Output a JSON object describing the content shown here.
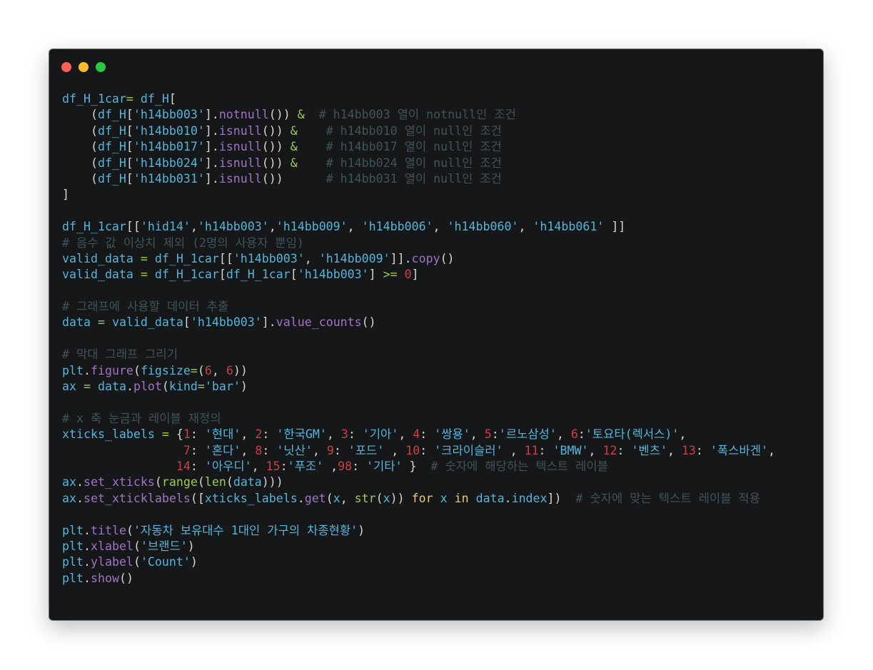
{
  "window": {
    "controls": [
      {
        "name": "close",
        "color": "#ff5f57"
      },
      {
        "name": "minimize",
        "color": "#febc2e"
      },
      {
        "name": "maximize",
        "color": "#28c840"
      }
    ]
  },
  "code_lines": [
    [
      [
        "v",
        "df_H_1car"
      ],
      [
        "o",
        "="
      ],
      [
        "p",
        " "
      ],
      [
        "v",
        "df_H"
      ],
      [
        "p",
        "["
      ]
    ],
    [
      [
        "p",
        "    ("
      ],
      [
        "v",
        "df_H"
      ],
      [
        "p",
        "["
      ],
      [
        "s",
        "'h14bb003'"
      ],
      [
        "p",
        "]."
      ],
      [
        "f",
        "notnull"
      ],
      [
        "p",
        "()) "
      ],
      [
        "o",
        "&"
      ],
      [
        "p",
        "  "
      ],
      [
        "c",
        "# h14bb003 열이 notnull인 조건"
      ]
    ],
    [
      [
        "p",
        "    ("
      ],
      [
        "v",
        "df_H"
      ],
      [
        "p",
        "["
      ],
      [
        "s",
        "'h14bb010'"
      ],
      [
        "p",
        "]."
      ],
      [
        "f",
        "isnull"
      ],
      [
        "p",
        "()) "
      ],
      [
        "o",
        "&"
      ],
      [
        "p",
        "    "
      ],
      [
        "c",
        "# h14bb010 열이 null인 조건"
      ]
    ],
    [
      [
        "p",
        "    ("
      ],
      [
        "v",
        "df_H"
      ],
      [
        "p",
        "["
      ],
      [
        "s",
        "'h14bb017'"
      ],
      [
        "p",
        "]."
      ],
      [
        "f",
        "isnull"
      ],
      [
        "p",
        "()) "
      ],
      [
        "o",
        "&"
      ],
      [
        "p",
        "    "
      ],
      [
        "c",
        "# h14bb017 열이 null인 조건"
      ]
    ],
    [
      [
        "p",
        "    ("
      ],
      [
        "v",
        "df_H"
      ],
      [
        "p",
        "["
      ],
      [
        "s",
        "'h14bb024'"
      ],
      [
        "p",
        "]."
      ],
      [
        "f",
        "isnull"
      ],
      [
        "p",
        "()) "
      ],
      [
        "o",
        "&"
      ],
      [
        "p",
        "    "
      ],
      [
        "c",
        "# h14bb024 열이 null인 조건"
      ]
    ],
    [
      [
        "p",
        "    ("
      ],
      [
        "v",
        "df_H"
      ],
      [
        "p",
        "["
      ],
      [
        "s",
        "'h14bb031'"
      ],
      [
        "p",
        "]."
      ],
      [
        "f",
        "isnull"
      ],
      [
        "p",
        "())      "
      ],
      [
        "c",
        "# h14bb031 열이 null인 조건"
      ]
    ],
    [
      [
        "p",
        "]"
      ]
    ],
    [],
    [
      [
        "v",
        "df_H_1car"
      ],
      [
        "p",
        "[["
      ],
      [
        "s",
        "'hid14'"
      ],
      [
        "p",
        ","
      ],
      [
        "s",
        "'h14bb003'"
      ],
      [
        "p",
        ","
      ],
      [
        "s",
        "'h14bb009'"
      ],
      [
        "p",
        ", "
      ],
      [
        "s",
        "'h14bb006'"
      ],
      [
        "p",
        ", "
      ],
      [
        "s",
        "'h14bb060'"
      ],
      [
        "p",
        ", "
      ],
      [
        "s",
        "'h14bb061'"
      ],
      [
        "p",
        " ]]"
      ]
    ],
    [
      [
        "c",
        "# 음수 값 이상치 제외 (2명의 사용자 뿐임)"
      ]
    ],
    [
      [
        "v",
        "valid_data"
      ],
      [
        "p",
        " "
      ],
      [
        "o",
        "="
      ],
      [
        "p",
        " "
      ],
      [
        "v",
        "df_H_1car"
      ],
      [
        "p",
        "[["
      ],
      [
        "s",
        "'h14bb003'"
      ],
      [
        "p",
        ", "
      ],
      [
        "s",
        "'h14bb009'"
      ],
      [
        "p",
        "]]."
      ],
      [
        "f",
        "copy"
      ],
      [
        "p",
        "()"
      ]
    ],
    [
      [
        "v",
        "valid_data"
      ],
      [
        "p",
        " "
      ],
      [
        "o",
        "="
      ],
      [
        "p",
        " "
      ],
      [
        "v",
        "df_H_1car"
      ],
      [
        "p",
        "["
      ],
      [
        "v",
        "df_H_1car"
      ],
      [
        "p",
        "["
      ],
      [
        "s",
        "'h14bb003'"
      ],
      [
        "p",
        "] "
      ],
      [
        "o",
        ">="
      ],
      [
        "p",
        " "
      ],
      [
        "n",
        "0"
      ],
      [
        "p",
        "]"
      ]
    ],
    [],
    [
      [
        "c",
        "# 그래프에 사용할 데이터 추출"
      ]
    ],
    [
      [
        "v",
        "data"
      ],
      [
        "p",
        " "
      ],
      [
        "o",
        "="
      ],
      [
        "p",
        " "
      ],
      [
        "v",
        "valid_data"
      ],
      [
        "p",
        "["
      ],
      [
        "s",
        "'h14bb003'"
      ],
      [
        "p",
        "]."
      ],
      [
        "f",
        "value_counts"
      ],
      [
        "p",
        "()"
      ]
    ],
    [],
    [
      [
        "c",
        "# 막대 그래프 그리기"
      ]
    ],
    [
      [
        "v",
        "plt"
      ],
      [
        "p",
        "."
      ],
      [
        "f",
        "figure"
      ],
      [
        "p",
        "("
      ],
      [
        "v",
        "figsize"
      ],
      [
        "o",
        "="
      ],
      [
        "p",
        "("
      ],
      [
        "n",
        "6"
      ],
      [
        "p",
        ", "
      ],
      [
        "n",
        "6"
      ],
      [
        "p",
        "))"
      ]
    ],
    [
      [
        "v",
        "ax"
      ],
      [
        "p",
        " "
      ],
      [
        "o",
        "="
      ],
      [
        "p",
        " "
      ],
      [
        "v",
        "data"
      ],
      [
        "p",
        "."
      ],
      [
        "f",
        "plot"
      ],
      [
        "p",
        "("
      ],
      [
        "v",
        "kind"
      ],
      [
        "o",
        "="
      ],
      [
        "s",
        "'bar'"
      ],
      [
        "p",
        ")"
      ]
    ],
    [],
    [
      [
        "c",
        "# x 축 눈금과 레이블 재정의"
      ]
    ],
    [
      [
        "v",
        "xticks_labels"
      ],
      [
        "p",
        " "
      ],
      [
        "o",
        "="
      ],
      [
        "p",
        " {"
      ],
      [
        "n",
        "1"
      ],
      [
        "p",
        ": "
      ],
      [
        "s",
        "'현대'"
      ],
      [
        "p",
        ", "
      ],
      [
        "n",
        "2"
      ],
      [
        "p",
        ": "
      ],
      [
        "s",
        "'한국GM'"
      ],
      [
        "p",
        ", "
      ],
      [
        "n",
        "3"
      ],
      [
        "p",
        ": "
      ],
      [
        "s",
        "'기아'"
      ],
      [
        "p",
        ", "
      ],
      [
        "n",
        "4"
      ],
      [
        "p",
        ": "
      ],
      [
        "s",
        "'쌍용'"
      ],
      [
        "p",
        ", "
      ],
      [
        "n",
        "5"
      ],
      [
        "p",
        ":"
      ],
      [
        "s",
        "'르노삼성'"
      ],
      [
        "p",
        ", "
      ],
      [
        "n",
        "6"
      ],
      [
        "p",
        ":"
      ],
      [
        "s",
        "'토요타(렉서스)'"
      ],
      [
        "p",
        ","
      ]
    ],
    [
      [
        "p",
        "                 "
      ],
      [
        "n",
        "7"
      ],
      [
        "p",
        ": "
      ],
      [
        "s",
        "'혼다'"
      ],
      [
        "p",
        ", "
      ],
      [
        "n",
        "8"
      ],
      [
        "p",
        ": "
      ],
      [
        "s",
        "'닛산'"
      ],
      [
        "p",
        ", "
      ],
      [
        "n",
        "9"
      ],
      [
        "p",
        ": "
      ],
      [
        "s",
        "'포드'"
      ],
      [
        "p",
        " , "
      ],
      [
        "n",
        "10"
      ],
      [
        "p",
        ": "
      ],
      [
        "s",
        "'크라이슬러'"
      ],
      [
        "p",
        " , "
      ],
      [
        "n",
        "11"
      ],
      [
        "p",
        ": "
      ],
      [
        "s",
        "'BMW'"
      ],
      [
        "p",
        ", "
      ],
      [
        "n",
        "12"
      ],
      [
        "p",
        ": "
      ],
      [
        "s",
        "'벤츠'"
      ],
      [
        "p",
        ", "
      ],
      [
        "n",
        "13"
      ],
      [
        "p",
        ": "
      ],
      [
        "s",
        "'폭스바겐'"
      ],
      [
        "p",
        ","
      ]
    ],
    [
      [
        "p",
        "                "
      ],
      [
        "n",
        "14"
      ],
      [
        "p",
        ": "
      ],
      [
        "s",
        "'아우디'"
      ],
      [
        "p",
        ", "
      ],
      [
        "n",
        "15"
      ],
      [
        "p",
        ":"
      ],
      [
        "s",
        "'푸조'"
      ],
      [
        "p",
        " ,"
      ],
      [
        "n",
        "98"
      ],
      [
        "p",
        ": "
      ],
      [
        "s",
        "'기타'"
      ],
      [
        "p",
        " }  "
      ],
      [
        "c",
        "# 숫자에 해당하는 텍스트 레이블"
      ]
    ],
    [
      [
        "v",
        "ax"
      ],
      [
        "p",
        "."
      ],
      [
        "f",
        "set_xticks"
      ],
      [
        "p",
        "("
      ],
      [
        "b",
        "range"
      ],
      [
        "p",
        "("
      ],
      [
        "b",
        "len"
      ],
      [
        "p",
        "("
      ],
      [
        "v",
        "data"
      ],
      [
        "p",
        ")))"
      ]
    ],
    [
      [
        "v",
        "ax"
      ],
      [
        "p",
        "."
      ],
      [
        "f",
        "set_xticklabels"
      ],
      [
        "p",
        "(["
      ],
      [
        "v",
        "xticks_labels"
      ],
      [
        "p",
        "."
      ],
      [
        "f",
        "get"
      ],
      [
        "p",
        "("
      ],
      [
        "v",
        "x"
      ],
      [
        "p",
        ", "
      ],
      [
        "b",
        "str"
      ],
      [
        "p",
        "("
      ],
      [
        "v",
        "x"
      ],
      [
        "p",
        ")) "
      ],
      [
        "k",
        "for"
      ],
      [
        "p",
        " "
      ],
      [
        "v",
        "x"
      ],
      [
        "p",
        " "
      ],
      [
        "k",
        "in"
      ],
      [
        "p",
        " "
      ],
      [
        "v",
        "data"
      ],
      [
        "p",
        "."
      ],
      [
        "v",
        "index"
      ],
      [
        "p",
        "])  "
      ],
      [
        "c",
        "# 숫자에 맞는 텍스트 레이블 적용"
      ]
    ],
    [],
    [
      [
        "v",
        "plt"
      ],
      [
        "p",
        "."
      ],
      [
        "f",
        "title"
      ],
      [
        "p",
        "("
      ],
      [
        "s",
        "'자동차 보유대수 1대인 가구의 차종현황'"
      ],
      [
        "p",
        ")"
      ]
    ],
    [
      [
        "v",
        "plt"
      ],
      [
        "p",
        "."
      ],
      [
        "f",
        "xlabel"
      ],
      [
        "p",
        "("
      ],
      [
        "s",
        "'브랜드'"
      ],
      [
        "p",
        ")"
      ]
    ],
    [
      [
        "v",
        "plt"
      ],
      [
        "p",
        "."
      ],
      [
        "f",
        "ylabel"
      ],
      [
        "p",
        "("
      ],
      [
        "s",
        "'Count'"
      ],
      [
        "p",
        ")"
      ]
    ],
    [
      [
        "v",
        "plt"
      ],
      [
        "p",
        "."
      ],
      [
        "f",
        "show"
      ],
      [
        "p",
        "()"
      ]
    ]
  ]
}
